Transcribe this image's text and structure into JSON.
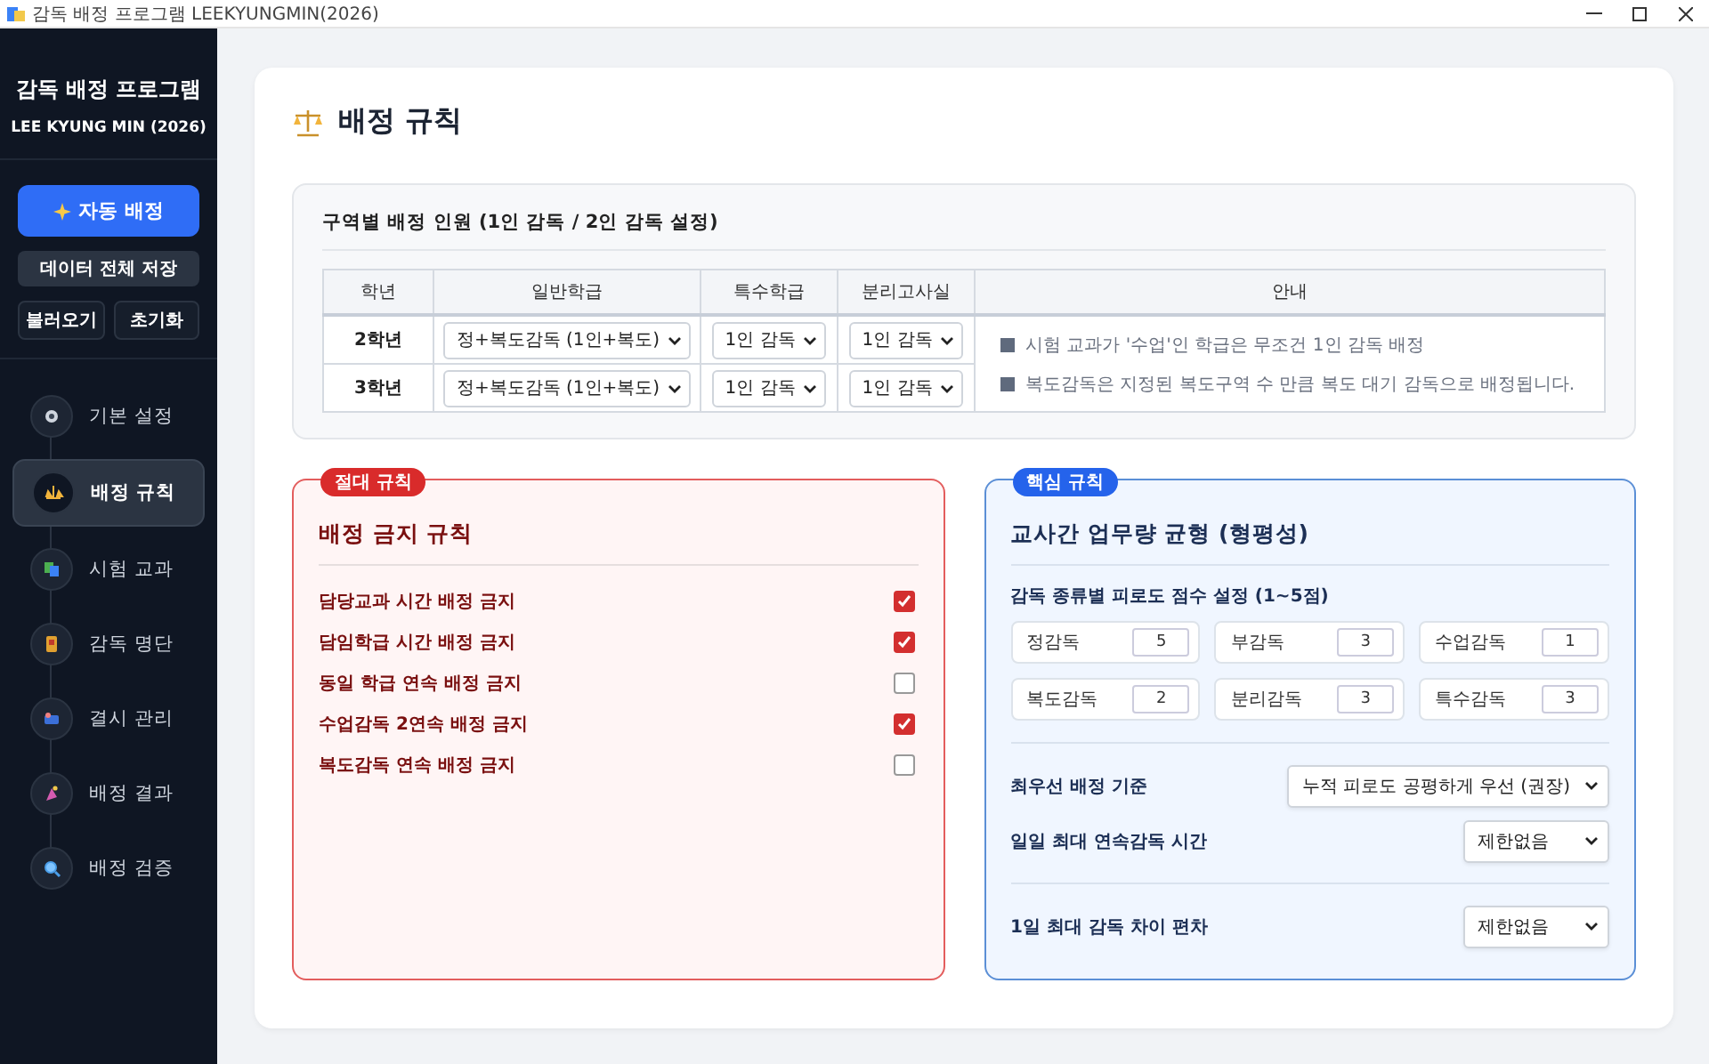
{
  "window": {
    "title": "감독 배정 프로그램 LEEKYUNGMIN(2026)"
  },
  "sidebar": {
    "title": "감독 배정 프로그램",
    "subtitle": "LEE KYUNG MIN (2026)",
    "primary_button": "자동 배정",
    "save_button": "데이터 전체 저장",
    "small_buttons": [
      "불러오기",
      "초기화"
    ],
    "nav": [
      {
        "label": "기본 설정",
        "selected": false
      },
      {
        "label": "배정 규칙",
        "selected": true
      },
      {
        "label": "시험 교과",
        "selected": false
      },
      {
        "label": "감독 명단",
        "selected": false
      },
      {
        "label": "결시 관리",
        "selected": false
      },
      {
        "label": "배정 결과",
        "selected": false
      },
      {
        "label": "배정 검증",
        "selected": false
      }
    ]
  },
  "page_title": "배정 규칙",
  "zone_section": {
    "title": "구역별 배정 인원 (1인 감독 / 2인 감독 설정)",
    "columns": [
      "학년",
      "일반학급",
      "특수학급",
      "분리고사실",
      "안내"
    ],
    "rows": [
      {
        "grade": "2학년",
        "general": "정+복도감독 (1인+복도)",
        "special": "1인 감독",
        "separate": "1인 감독"
      },
      {
        "grade": "3학년",
        "general": "정+복도감독 (1인+복도)",
        "special": "1인 감독",
        "separate": "1인 감독"
      }
    ],
    "notes": [
      "시험 교과가 '수업'인 학급은 무조건 1인 감독 배정",
      "복도감독은 지정된 복도구역 수 만큼 복도 대기 감독으로 배정됩니다."
    ]
  },
  "ban_rules": {
    "badge": "절대 규칙",
    "title": "배정 금지 규칙",
    "rules": [
      {
        "label": "담당교과 시간 배정 금지",
        "checked": true
      },
      {
        "label": "담임학급 시간 배정 금지",
        "checked": true
      },
      {
        "label": "동일 학급 연속 배정 금지",
        "checked": false
      },
      {
        "label": "수업감독 2연속 배정 금지",
        "checked": true
      },
      {
        "label": "복도감독 연속 배정 금지",
        "checked": false
      }
    ]
  },
  "balance": {
    "badge": "핵심 규칙",
    "title": "교사간 업무량 균형 (형평성)",
    "fatigue_label": "감독 종류별 피로도 점수 설정 (1~5점)",
    "fatigue": [
      {
        "label": "정감독",
        "value": "5"
      },
      {
        "label": "부감독",
        "value": "3"
      },
      {
        "label": "수업감독",
        "value": "1"
      },
      {
        "label": "복도감독",
        "value": "2"
      },
      {
        "label": "분리감독",
        "value": "3"
      },
      {
        "label": "특수감독",
        "value": "3"
      }
    ],
    "setting_groups": [
      [
        {
          "label": "최우선 배정 기준",
          "value": "누적 피로도 공평하게 우선 (권장)"
        },
        {
          "label": "일일 최대 연속감독 시간",
          "value": "제한없음"
        }
      ],
      [
        {
          "label": "1일 최대 감독 차이 편차",
          "value": "제한없음"
        }
      ]
    ]
  }
}
